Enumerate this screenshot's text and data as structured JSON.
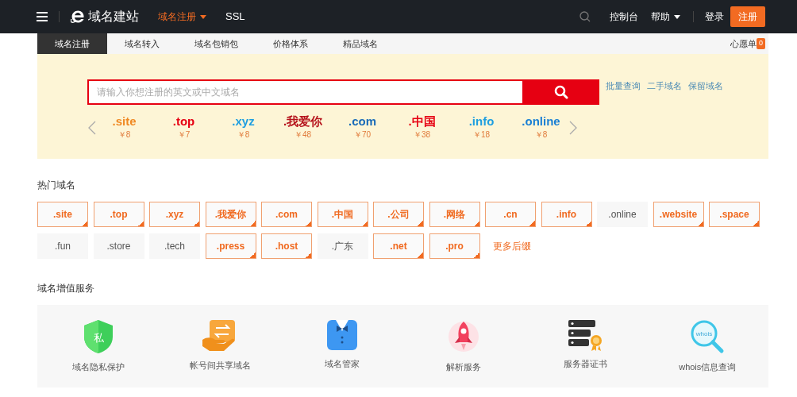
{
  "navbar": {
    "brand": "域名建站",
    "menu": [
      {
        "label": "域名注册",
        "selected": true,
        "dropdown": true
      },
      {
        "label": "SSL",
        "selected": false,
        "dropdown": false
      }
    ],
    "right": [
      {
        "label": "控制台",
        "dropdown": false
      },
      {
        "label": "帮助",
        "dropdown": true
      }
    ],
    "login": "登录",
    "register": "注册"
  },
  "subnav": {
    "tabs": [
      {
        "label": "域名注册",
        "selected": true
      },
      {
        "label": "域名转入",
        "selected": false
      },
      {
        "label": "域名包销包",
        "selected": false
      },
      {
        "label": "价格体系",
        "selected": false
      },
      {
        "label": "精品域名",
        "selected": false
      }
    ],
    "wishlist": "心愿单",
    "wishlist_count": "0"
  },
  "search": {
    "placeholder": "请输入你想注册的英文或中文域名",
    "links": [
      "批量查询",
      "二手域名",
      "保留域名"
    ]
  },
  "featured": [
    {
      "name": ".site",
      "price": "￥8",
      "color": "#f08a24"
    },
    {
      "name": ".top",
      "price": "￥7",
      "color": "#e60012"
    },
    {
      "name": ".xyz",
      "price": "￥8",
      "color": "#1e9ee0"
    },
    {
      "name": ".我爱你",
      "price": "￥48",
      "color": "#b5121b"
    },
    {
      "name": ".com",
      "price": "￥70",
      "color": "#1a6bb8"
    },
    {
      "name": ".中国",
      "price": "￥38",
      "color": "#e60012"
    },
    {
      "name": ".info",
      "price": "￥18",
      "color": "#1e9ee0"
    },
    {
      "name": ".online",
      "price": "￥8",
      "color": "#1a7fd4"
    }
  ],
  "hot": {
    "title": "热门域名",
    "items": [
      {
        "name": ".site",
        "highlighted": true
      },
      {
        "name": ".top",
        "highlighted": true
      },
      {
        "name": ".xyz",
        "highlighted": true
      },
      {
        "name": ".我爱你",
        "highlighted": true
      },
      {
        "name": ".com",
        "highlighted": true
      },
      {
        "name": ".中国",
        "highlighted": true
      },
      {
        "name": ".公司",
        "highlighted": true
      },
      {
        "name": ".网络",
        "highlighted": true
      },
      {
        "name": ".cn",
        "highlighted": true
      },
      {
        "name": ".info",
        "highlighted": true
      },
      {
        "name": ".online",
        "highlighted": false
      },
      {
        "name": ".website",
        "highlighted": true
      },
      {
        "name": ".space",
        "highlighted": true
      },
      {
        "name": ".fun",
        "highlighted": false
      },
      {
        "name": ".store",
        "highlighted": false
      },
      {
        "name": ".tech",
        "highlighted": false
      },
      {
        "name": ".press",
        "highlighted": true
      },
      {
        "name": ".host",
        "highlighted": true
      },
      {
        "name": ".广东",
        "highlighted": false
      },
      {
        "name": ".net",
        "highlighted": true
      },
      {
        "name": ".pro",
        "highlighted": true
      }
    ],
    "more": "更多后缀"
  },
  "services": {
    "title": "域名增值服务",
    "items": [
      {
        "label": "域名隐私保护",
        "kind": "shield",
        "icon_text": "私"
      },
      {
        "label": "帐号间共享域名",
        "kind": "share"
      },
      {
        "label": "域名管家",
        "kind": "butler"
      },
      {
        "label": "解析服务",
        "kind": "rocket"
      },
      {
        "label": "服务器证书",
        "kind": "server"
      },
      {
        "label": "whois信息查询",
        "kind": "whois",
        "icon_text": "whois"
      }
    ]
  }
}
